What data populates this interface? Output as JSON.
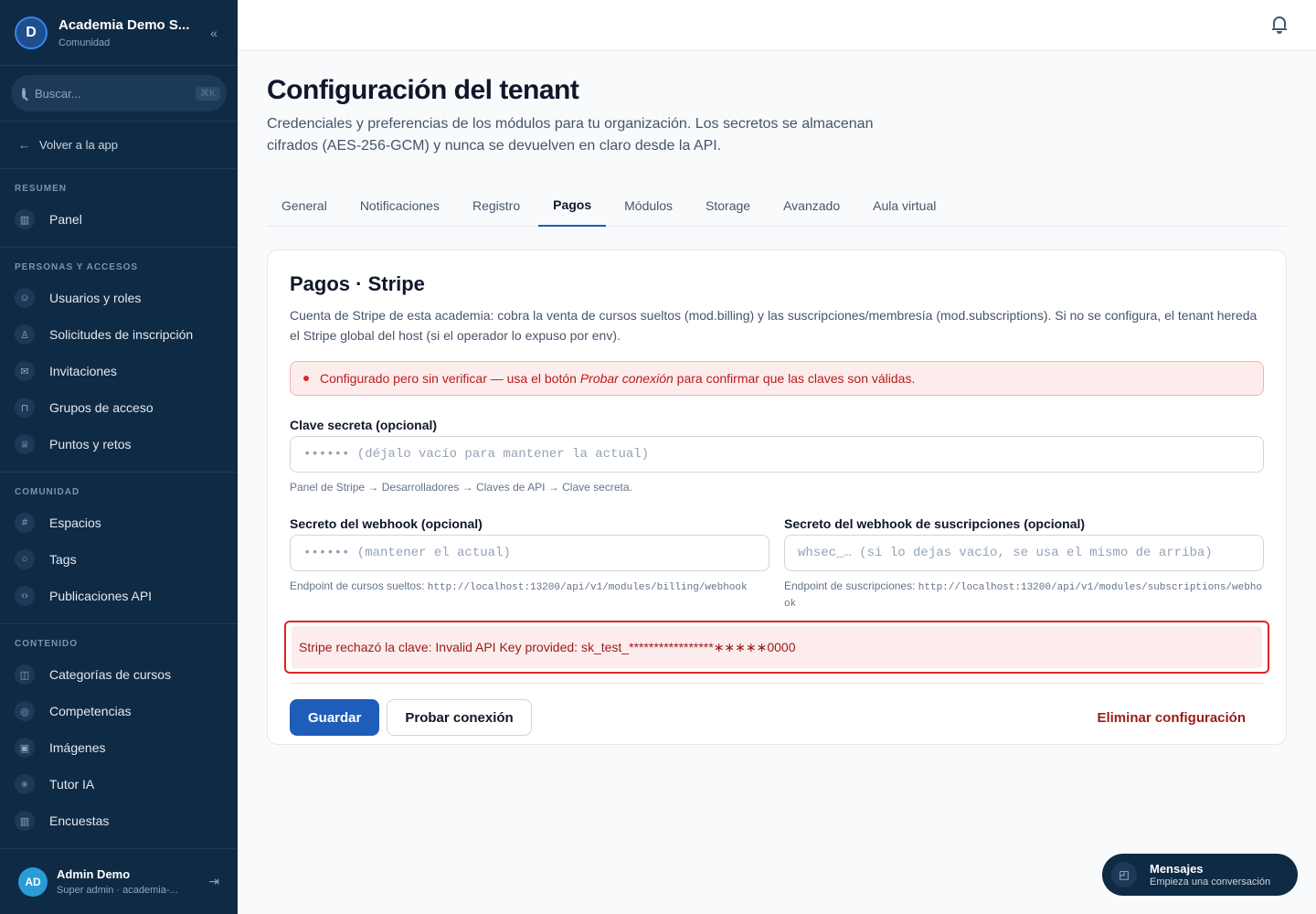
{
  "brand": {
    "name": "Academia Demo S...",
    "subtitle": "Comunidad",
    "logo": "D"
  },
  "search": {
    "placeholder": "Buscar...",
    "shortcut": "⌘K"
  },
  "back_label": "Volver a la app",
  "sidebar": {
    "sections": [
      {
        "title": "RESUMEN",
        "items": [
          {
            "label": "Panel",
            "icon": "bar-chart-icon"
          }
        ]
      },
      {
        "title": "PERSONAS Y ACCESOS",
        "items": [
          {
            "label": "Usuarios y roles",
            "icon": "users-icon"
          },
          {
            "label": "Solicitudes de inscripción",
            "icon": "user-icon"
          },
          {
            "label": "Invitaciones",
            "icon": "mail-icon"
          },
          {
            "label": "Grupos de acceso",
            "icon": "lock-icon"
          },
          {
            "label": "Puntos y retos",
            "icon": "trophy-icon"
          }
        ]
      },
      {
        "title": "COMUNIDAD",
        "items": [
          {
            "label": "Espacios",
            "icon": "hash-icon"
          },
          {
            "label": "Tags",
            "icon": "chat-icon"
          },
          {
            "label": "Publicaciones API",
            "icon": "code-icon"
          }
        ]
      },
      {
        "title": "CONTENIDO",
        "items": [
          {
            "label": "Categorías de cursos",
            "icon": "book-icon"
          },
          {
            "label": "Competencias",
            "icon": "badge-icon"
          },
          {
            "label": "Imágenes",
            "icon": "image-icon"
          },
          {
            "label": "Tutor IA",
            "icon": "sparkle-icon"
          },
          {
            "label": "Encuestas",
            "icon": "bar-chart-icon"
          }
        ]
      }
    ]
  },
  "user": {
    "initials": "AD",
    "name": "Admin Demo",
    "role": "Super admin · academia-..."
  },
  "page": {
    "title": "Configuración del tenant",
    "description": "Credenciales y preferencias de los módulos para tu organización. Los secretos se almacenan cifrados (AES-256-GCM) y nunca se devuelven en claro desde la API."
  },
  "tabs": [
    "General",
    "Notificaciones",
    "Registro",
    "Pagos",
    "Módulos",
    "Storage",
    "Avanzado",
    "Aula virtual"
  ],
  "active_tab": "Pagos",
  "card": {
    "title": "Pagos · Stripe",
    "description": "Cuenta de Stripe de esta academia: cobra la venta de cursos sueltos (mod.billing) y las suscripciones/membresía (mod.subscriptions). Si no se configura, el tenant hereda el Stripe global del host (si el operador lo expuso por env).",
    "warning_prefix": "Configurado pero sin verificar — usa el botón ",
    "warning_em": "Probar conexión",
    "warning_suffix": " para confirmar que las claves son válidas.",
    "secret": {
      "label": "Clave secreta (opcional)",
      "placeholder": "•••••• (déjalo vacío para mantener la actual)",
      "value": "",
      "help": "Panel de Stripe → Desarrolladores → Claves de API → Clave secreta."
    },
    "webhook": {
      "label": "Secreto del webhook (opcional)",
      "placeholder": "•••••• (mantener el actual)",
      "value": "",
      "help_prefix": "Endpoint de cursos sueltos: ",
      "help_url": "http://localhost:13200/api/v1/modules/billing/webhook"
    },
    "webhook_subs": {
      "label": "Secreto del webhook de suscripciones (opcional)",
      "placeholder": "whsec_… (si lo dejas vacío, se usa el mismo de arriba)",
      "value": "",
      "help_prefix": "Endpoint de suscripciones: ",
      "help_url": "http://localhost:13200/api/v1/modules/subscriptions/webhook"
    },
    "error": "Stripe rechazó la clave: Invalid API Key provided: sk_test_*****************∗∗∗∗∗0000",
    "save_label": "Guardar",
    "test_label": "Probar conexión",
    "delete_label": "Eliminar configuración"
  },
  "messages": {
    "title": "Mensajes",
    "subtitle": "Empieza una conversación"
  },
  "colors": {
    "sidebar": "#0f2a44",
    "primary": "#1e5eb8",
    "danger": "#dc2626",
    "danger_bg": "#fdecec"
  }
}
